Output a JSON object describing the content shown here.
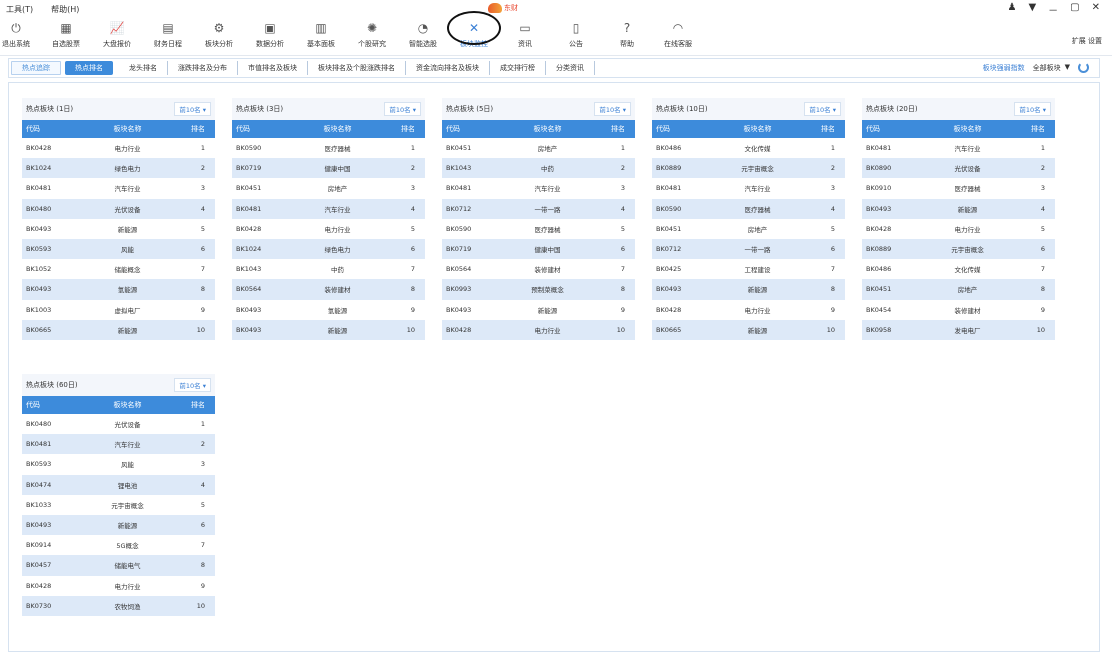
{
  "titlebar": {
    "items": [
      "工具(T)",
      "帮助(H)"
    ],
    "logo_text": "东财",
    "window_controls": [
      "－",
      "▢",
      "✕"
    ]
  },
  "toolbar": {
    "items": [
      {
        "label": "退出系统",
        "icon": "power-icon"
      },
      {
        "label": "自选股票",
        "icon": "grid-icon"
      },
      {
        "label": "大盘报价",
        "icon": "chart-icon"
      },
      {
        "label": "财务日程",
        "icon": "calendar-icon"
      },
      {
        "label": "板块分析",
        "icon": "gear-icon"
      },
      {
        "label": "数据分析",
        "icon": "monitor-icon"
      },
      {
        "label": "基本面板",
        "icon": "book-icon"
      },
      {
        "label": "个股研究",
        "icon": "brain-icon"
      },
      {
        "label": "智能选股",
        "icon": "gauge-icon"
      },
      {
        "label": "板块监控",
        "icon": "radar-icon",
        "active": true
      },
      {
        "label": "资讯",
        "icon": "news-icon"
      },
      {
        "label": "公告",
        "icon": "doc-icon"
      },
      {
        "label": "帮助",
        "icon": "help-icon"
      },
      {
        "label": "在线客服",
        "icon": "headset-icon"
      }
    ],
    "right_text": "扩展 设置"
  },
  "tabs": {
    "items": [
      "热点追踪",
      "热点排名",
      "龙头排名",
      "涨跌排名及分布",
      "市值排名及板块",
      "板块排名及个股涨跌排名",
      "资金流向排名及板块",
      "成交排行榜",
      "分类资讯"
    ],
    "right_link": "板块强弱指数",
    "right_select": "全部板块",
    "right_caret": "▼"
  },
  "panels": [
    {
      "title": "热点板块 (1日)",
      "dropdown": "前10名",
      "headers": [
        "代码",
        "板块名称",
        "排名"
      ],
      "rows": [
        [
          "BK0428",
          "电力行业",
          "1"
        ],
        [
          "BK1024",
          "绿色电力",
          "2"
        ],
        [
          "BK0481",
          "汽车行业",
          "3"
        ],
        [
          "BK0480",
          "光伏设备",
          "4"
        ],
        [
          "BK0493",
          "新能源",
          "5"
        ],
        [
          "BK0593",
          "风能",
          "6"
        ],
        [
          "BK1052",
          "储能概念",
          "7"
        ],
        [
          "BK0493",
          "氢能源",
          "8"
        ],
        [
          "BK1003",
          "虚拟电厂",
          "9"
        ],
        [
          "BK0665",
          "新能源",
          "10"
        ]
      ]
    },
    {
      "title": "热点板块 (3日)",
      "dropdown": "前10名",
      "headers": [
        "代码",
        "板块名称",
        "排名"
      ],
      "rows": [
        [
          "BK0590",
          "医疗器械",
          "1"
        ],
        [
          "BK0719",
          "健康中国",
          "2"
        ],
        [
          "BK0451",
          "房地产",
          "3"
        ],
        [
          "BK0481",
          "汽车行业",
          "4"
        ],
        [
          "BK0428",
          "电力行业",
          "5"
        ],
        [
          "BK1024",
          "绿色电力",
          "6"
        ],
        [
          "BK1043",
          "中药",
          "7"
        ],
        [
          "BK0564",
          "装修建材",
          "8"
        ],
        [
          "BK0493",
          "氢能源",
          "9"
        ],
        [
          "BK0493",
          "新能源",
          "10"
        ]
      ]
    },
    {
      "title": "热点板块 (5日)",
      "dropdown": "前10名",
      "headers": [
        "代码",
        "板块名称",
        "排名"
      ],
      "rows": [
        [
          "BK0451",
          "房地产",
          "1"
        ],
        [
          "BK1043",
          "中药",
          "2"
        ],
        [
          "BK0481",
          "汽车行业",
          "3"
        ],
        [
          "BK0712",
          "一带一路",
          "4"
        ],
        [
          "BK0590",
          "医疗器械",
          "5"
        ],
        [
          "BK0719",
          "健康中国",
          "6"
        ],
        [
          "BK0564",
          "装修建材",
          "7"
        ],
        [
          "BK0993",
          "预制菜概念",
          "8"
        ],
        [
          "BK0493",
          "新能源",
          "9"
        ],
        [
          "BK0428",
          "电力行业",
          "10"
        ]
      ]
    },
    {
      "title": "热点板块 (10日)",
      "dropdown": "前10名",
      "headers": [
        "代码",
        "板块名称",
        "排名"
      ],
      "rows": [
        [
          "BK0486",
          "文化传媒",
          "1"
        ],
        [
          "BK0889",
          "元宇宙概念",
          "2"
        ],
        [
          "BK0481",
          "汽车行业",
          "3"
        ],
        [
          "BK0590",
          "医疗器械",
          "4"
        ],
        [
          "BK0451",
          "房地产",
          "5"
        ],
        [
          "BK0712",
          "一带一路",
          "6"
        ],
        [
          "BK0425",
          "工程建设",
          "7"
        ],
        [
          "BK0493",
          "新能源",
          "8"
        ],
        [
          "BK0428",
          "电力行业",
          "9"
        ],
        [
          "BK0665",
          "新能源",
          "10"
        ]
      ]
    },
    {
      "title": "热点板块 (20日)",
      "dropdown": "前10名",
      "headers": [
        "代码",
        "板块名称",
        "排名"
      ],
      "rows": [
        [
          "BK0481",
          "汽车行业",
          "1"
        ],
        [
          "BK0890",
          "光伏设备",
          "2"
        ],
        [
          "BK0910",
          "医疗器械",
          "3"
        ],
        [
          "BK0493",
          "新能源",
          "4"
        ],
        [
          "BK0428",
          "电力行业",
          "5"
        ],
        [
          "BK0889",
          "元宇宙概念",
          "6"
        ],
        [
          "BK0486",
          "文化传媒",
          "7"
        ],
        [
          "BK0451",
          "房地产",
          "8"
        ],
        [
          "BK0454",
          "装修建材",
          "9"
        ],
        [
          "BK0958",
          "发电电厂",
          "10"
        ]
      ]
    },
    {
      "title": "热点板块 (60日)",
      "dropdown": "前10名",
      "headers": [
        "代码",
        "板块名称",
        "排名"
      ],
      "rows": [
        [
          "BK0480",
          "光伏设备",
          "1"
        ],
        [
          "BK0481",
          "汽车行业",
          "2"
        ],
        [
          "BK0593",
          "风能",
          "3"
        ],
        [
          "BK0474",
          "锂电池",
          "4"
        ],
        [
          "BK1033",
          "元宇宙概念",
          "5"
        ],
        [
          "BK0493",
          "新能源",
          "6"
        ],
        [
          "BK0914",
          "5G概念",
          "7"
        ],
        [
          "BK0457",
          "储能电气",
          "8"
        ],
        [
          "BK0428",
          "电力行业",
          "9"
        ],
        [
          "BK0730",
          "农牧饲渔",
          "10"
        ]
      ]
    }
  ]
}
